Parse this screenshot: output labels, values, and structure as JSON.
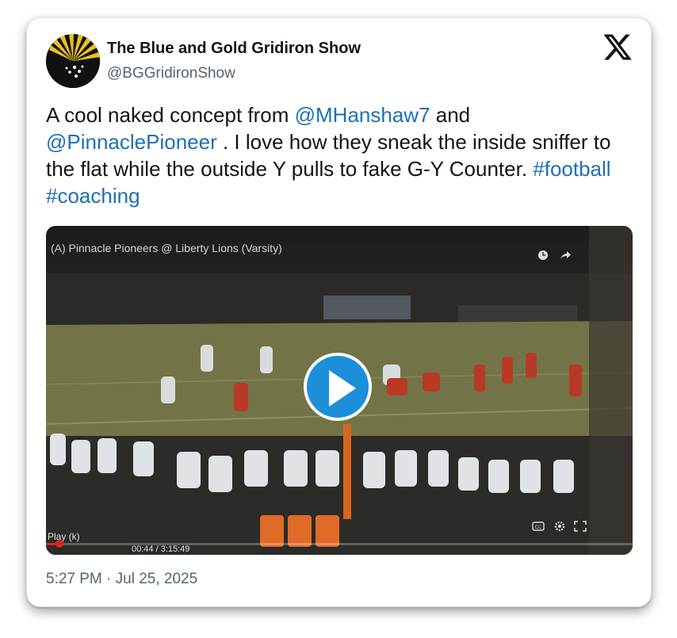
{
  "account": {
    "display_name": "The Blue and Gold Gridiron Show",
    "handle": "@BGGridironShow",
    "avatar_colors": {
      "background": "#111111",
      "rays": "#e8c21c"
    }
  },
  "brand_icon": "x-logo-icon",
  "tweet": {
    "segments": [
      {
        "type": "text",
        "value": "A cool naked concept from "
      },
      {
        "type": "mention",
        "value": "@MHanshaw7"
      },
      {
        "type": "text",
        "value": " and "
      },
      {
        "type": "mention",
        "value": "@PinnaclePioneer"
      },
      {
        "type": "text",
        "value": " . I love how they sneak the inside sniffer to the flat while the outside Y pulls to fake G-Y Counter. "
      },
      {
        "type": "hashtag",
        "value": "#football"
      },
      {
        "type": "text",
        "value": " "
      },
      {
        "type": "hashtag",
        "value": "#coaching"
      }
    ],
    "link_color": "#1d6fb8"
  },
  "media": {
    "video_title": "(A) Pinnacle Pioneers @ Liberty Lions (Varsity)",
    "play_label": "Play (k)",
    "time_display": "00:44 / 3:15:49",
    "progress": 0.0225,
    "progress_color": "#e0241b",
    "play_button_color": "#1d8fd8",
    "player_icons": [
      "clock-icon",
      "share-icon",
      "play-icon",
      "cc-icon",
      "settings-icon",
      "fullscreen-icon"
    ]
  },
  "timestamp": "5:27 PM · Jul 25, 2025"
}
